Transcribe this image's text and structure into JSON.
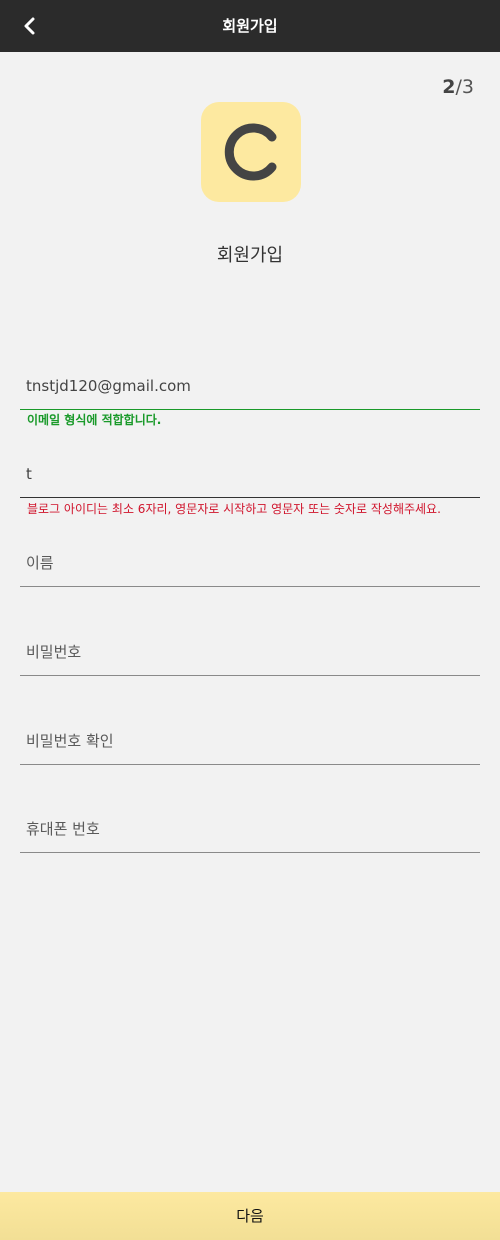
{
  "header": {
    "title": "회원가입",
    "back_icon": "chevron-left-icon"
  },
  "step": {
    "current": "2",
    "separator_total": "/3"
  },
  "logo": {
    "icon": "c-logo-icon",
    "bg_color": "#fde9a0",
    "fg_color": "#444444"
  },
  "page_title": "회원가입",
  "form": {
    "email": {
      "value": "tnstjd120@gmail.com",
      "message": "이메일 형식에 적합합니다."
    },
    "blog_id": {
      "value": "t",
      "message": "블로그 아이디는 최소 6자리, 영문자로 시작하고 영문자 또는 숫자로 작성해주세요."
    },
    "name": {
      "value": "",
      "placeholder": "이름"
    },
    "password": {
      "value": "",
      "placeholder": "비밀번호"
    },
    "password_confirm": {
      "value": "",
      "placeholder": "비밀번호 확인"
    },
    "phone": {
      "value": "",
      "placeholder": "휴대폰 번호"
    }
  },
  "next_button": {
    "label": "다음"
  },
  "colors": {
    "header_bg": "#2b2b2b",
    "success": "#1a9a2a",
    "error": "#d0142c",
    "accent": "#fde9a0"
  }
}
